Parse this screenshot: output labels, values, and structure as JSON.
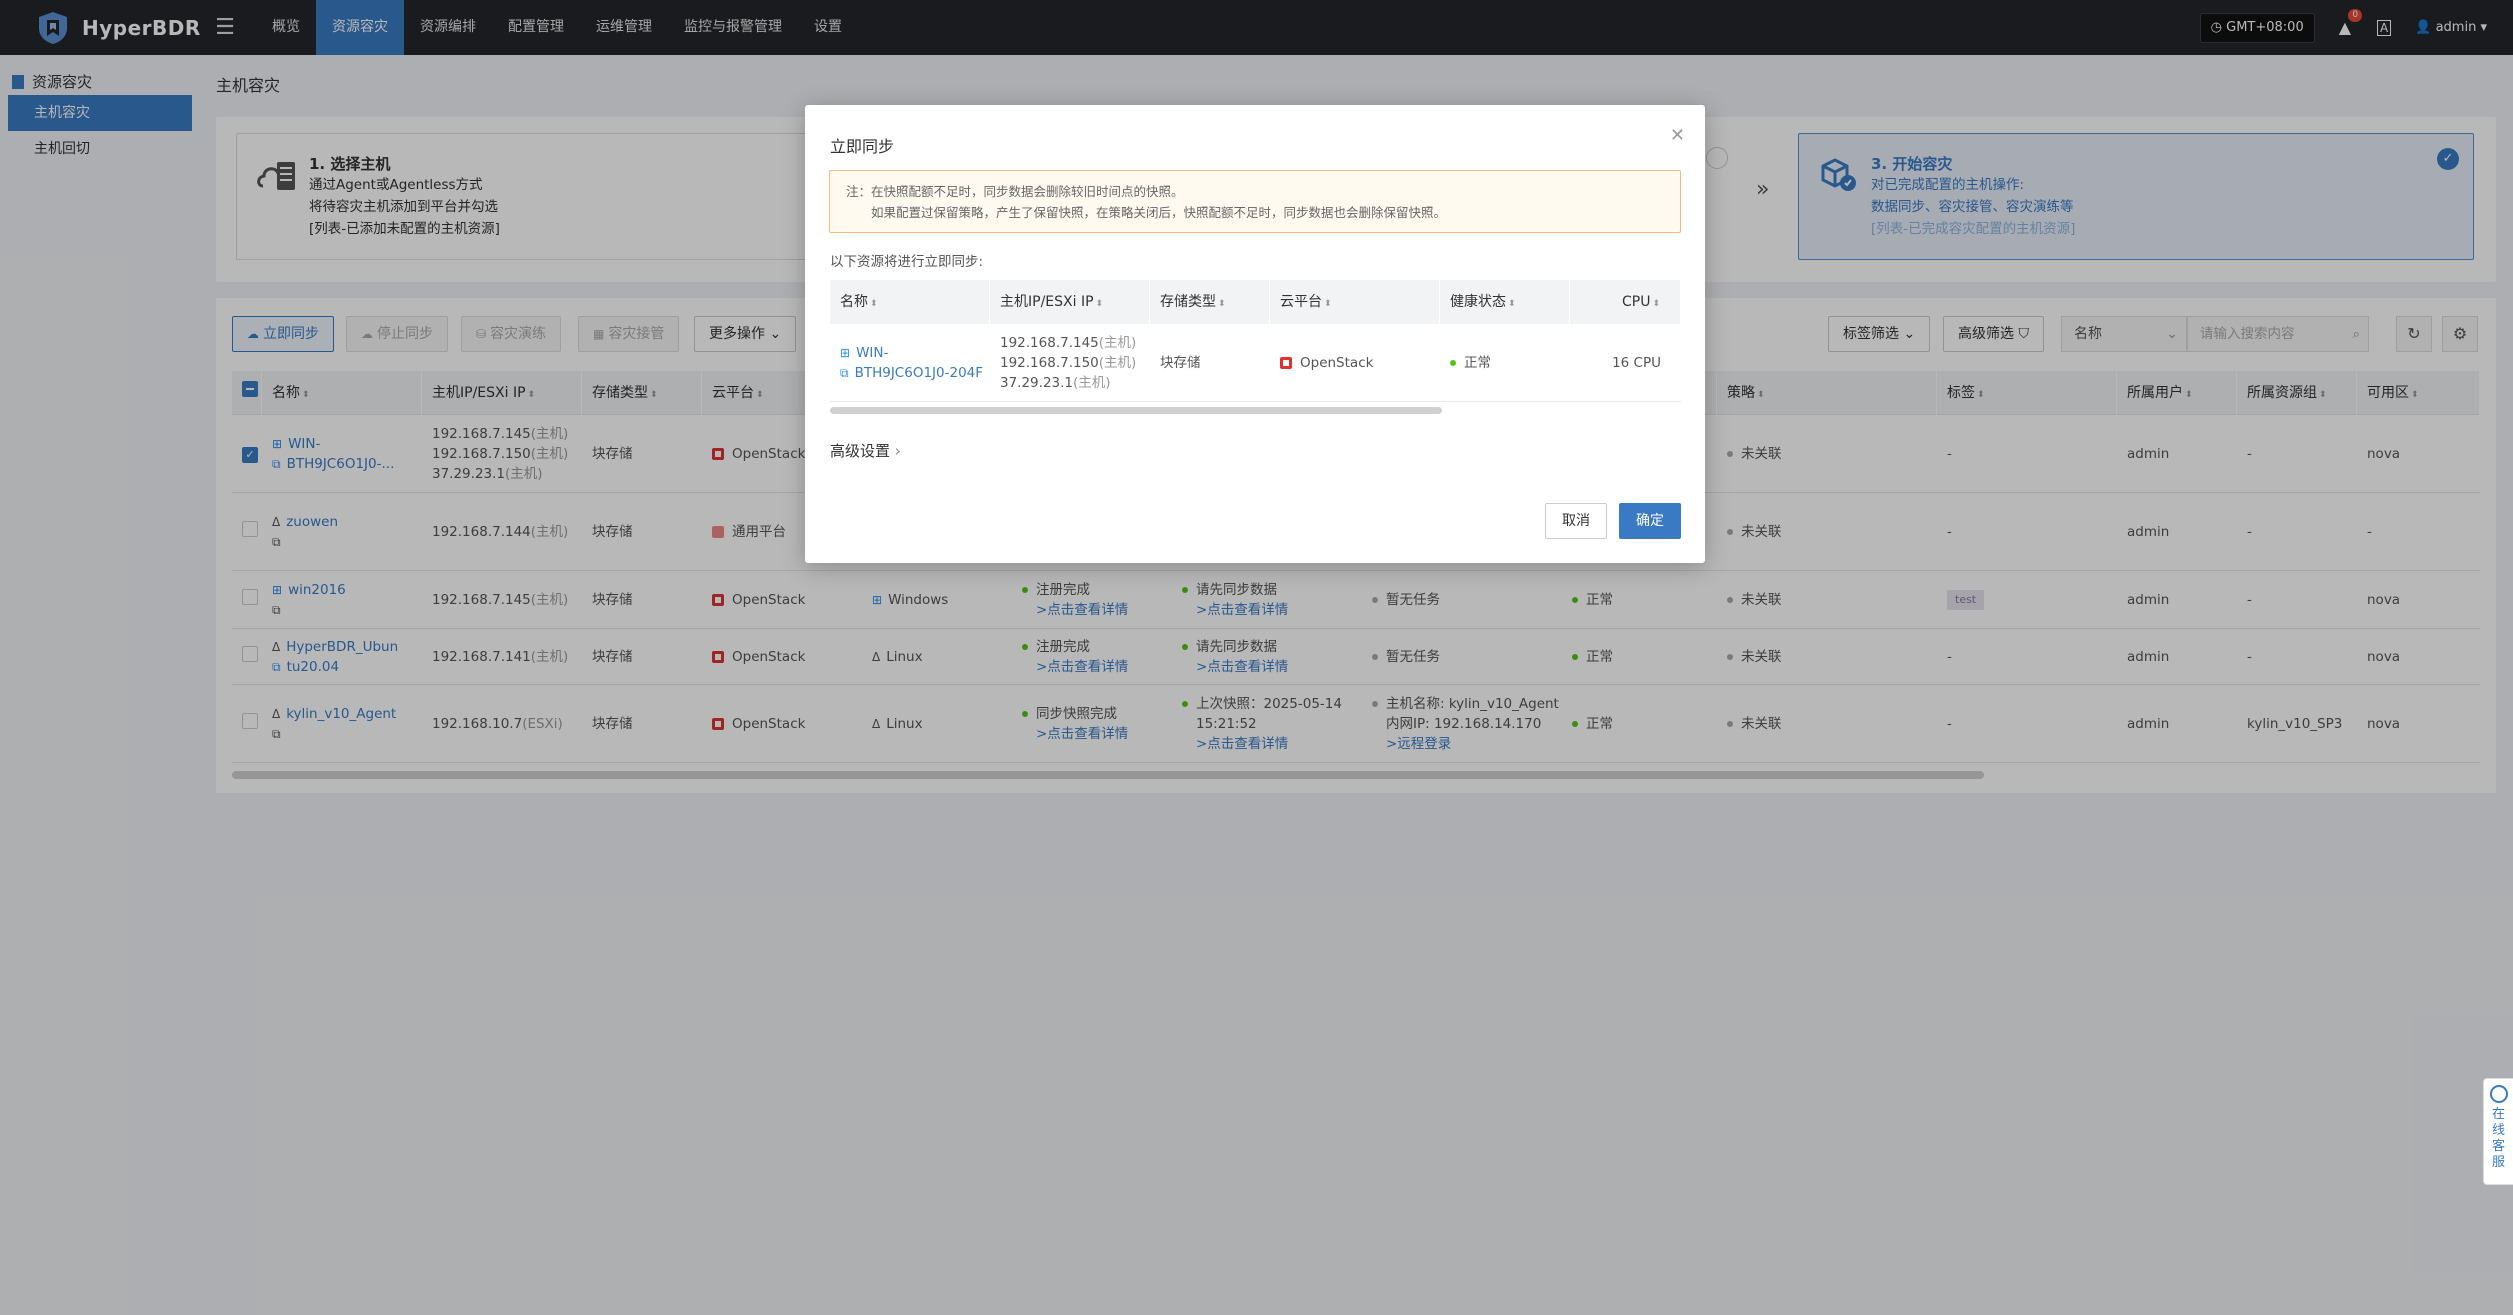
{
  "app": {
    "name": "HyperBDR"
  },
  "nav": {
    "menu_icon": "☰",
    "items": [
      "概览",
      "资源容灾",
      "资源编排",
      "配置管理",
      "运维管理",
      "监控与报警管理",
      "设置"
    ],
    "active_index": 1
  },
  "topbar": {
    "timezone": "GMT+08:00",
    "notification_count": "0",
    "lang": "A",
    "user": "admin"
  },
  "sidebar": {
    "group": "资源容灾",
    "items": [
      "主机容灾",
      "主机回切"
    ]
  },
  "page": {
    "title": "主机容灾"
  },
  "steps": {
    "step1": {
      "title": "1. 选择主机",
      "lines": [
        "通过Agent或Agentless方式",
        "将待容灾主机添加到平台并勾选"
      ],
      "note": "[列表-已添加未配置的主机资源]"
    },
    "step3": {
      "title": "3. 开始容灾",
      "lines": [
        "对已完成配置的主机操作:",
        "数据同步、容灾接管、容灾演练等"
      ],
      "note": "[列表-已完成容灾配置的主机资源]"
    }
  },
  "toolbar": {
    "sync": "立即同步",
    "stop_sync": "停止同步",
    "drill": "容灾演练",
    "takeover": "容灾接管",
    "more": "更多操作",
    "tag_filter": "标签筛选",
    "adv_filter": "高级筛选",
    "search_field": "名称",
    "search_placeholder": "请输入搜索内容"
  },
  "table": {
    "headers": [
      "名称",
      "主机IP/ESXi IP",
      "存储类型",
      "云平台",
      "策略",
      "标签",
      "所属用户",
      "所属资源组",
      "可用区"
    ],
    "rows": [
      {
        "name1": "WIN-",
        "name2": "BTH9JC6O1J0-...",
        "ips": [
          "192.168.7.145",
          "192.168.7.150",
          "37.29.23.1"
        ],
        "ip_suffix": [
          "(主机)",
          "(主机)",
          "(主机)"
        ],
        "storage": "块存储",
        "platform": "OpenStack",
        "os": "",
        "reg": [],
        "sync": [],
        "task": [],
        "health": "",
        "policy": "未关联",
        "tag": "-",
        "user": "admin",
        "group": "-",
        "zone": "nova",
        "checked": true
      },
      {
        "name1": "zuowen",
        "name2": "",
        "ips": [
          "192.168.7.144"
        ],
        "ip_suffix": [
          "(主机)"
        ],
        "storage": "块存储",
        "platform": "通用平台",
        "os": "",
        "reg": [],
        "sync": [],
        "task": [],
        "health": "",
        "policy": "未关联",
        "tag": "-",
        "user": "admin",
        "group": "-",
        "zone": "-"
      },
      {
        "name1": "win2016",
        "name2": "",
        "ips": [
          "192.168.7.145"
        ],
        "ip_suffix": [
          "(主机)"
        ],
        "storage": "块存储",
        "platform": "OpenStack",
        "os": "Windows",
        "reg": [
          "注册完成",
          ">点击查看详情"
        ],
        "sync": [
          "请先同步数据",
          ">点击查看详情"
        ],
        "task": [
          "暂无任务"
        ],
        "health": "正常",
        "policy": "未关联",
        "tag": "test",
        "user": "admin",
        "group": "-",
        "zone": "nova"
      },
      {
        "name1": "HyperBDR_Ubun",
        "name2": "tu20.04",
        "ips": [
          "192.168.7.141"
        ],
        "ip_suffix": [
          "(主机)"
        ],
        "storage": "块存储",
        "platform": "OpenStack",
        "os": "Linux",
        "reg": [
          "注册完成",
          ">点击查看详情"
        ],
        "sync": [
          "请先同步数据",
          ">点击查看详情"
        ],
        "task": [
          "暂无任务"
        ],
        "health": "正常",
        "policy": "未关联",
        "tag": "-",
        "user": "admin",
        "group": "-",
        "zone": "nova"
      },
      {
        "name1": "kylin_v10_Agent",
        "name2": "",
        "ips": [
          "192.168.10.7"
        ],
        "ip_suffix": [
          "(ESXi)"
        ],
        "storage": "块存储",
        "platform": "OpenStack",
        "os": "Linux",
        "reg": [
          "同步快照完成",
          ">点击查看详情"
        ],
        "sync": [
          "上次快照：2025-05-14",
          "15:21:52",
          ">点击查看详情"
        ],
        "task": [
          "主机名称: kylin_v10_Agent",
          "内网IP: 192.168.14.170",
          ">远程登录"
        ],
        "health": "正常",
        "policy": "未关联",
        "tag": "-",
        "user": "admin",
        "group": "kylin_v10_SP3",
        "zone": "nova"
      }
    ]
  },
  "dialog": {
    "title": "立即同步",
    "notice_line1": "注：在快照配额不足时，同步数据会删除较旧时间点的快照。",
    "notice_line2": "如果配置过保留策略，产生了保留快照，在策略关闭后，快照配额不足时，同步数据也会删除保留快照。",
    "lead": "以下资源将进行立即同步:",
    "headers": [
      "名称",
      "主机IP/ESXi IP",
      "存储类型",
      "云平台",
      "健康状态",
      "CPU"
    ],
    "row": {
      "name1": "WIN-",
      "name2": "BTH9JC6O1J0-204F",
      "ips": [
        "192.168.7.145",
        "192.168.7.150",
        "37.29.23.1"
      ],
      "ip_suffix": [
        "(主机)",
        "(主机)",
        "(主机)"
      ],
      "storage": "块存储",
      "platform": "OpenStack",
      "health": "正常",
      "cpu": "16 CPU"
    },
    "advanced": "高级设置",
    "cancel": "取消",
    "ok": "确定"
  },
  "service": {
    "label": "在线客服"
  },
  "colors": {
    "topbar": "#23262b",
    "accent": "#3a7ac4",
    "health_ok": "#52c41a",
    "platform_red": "#d33333"
  }
}
